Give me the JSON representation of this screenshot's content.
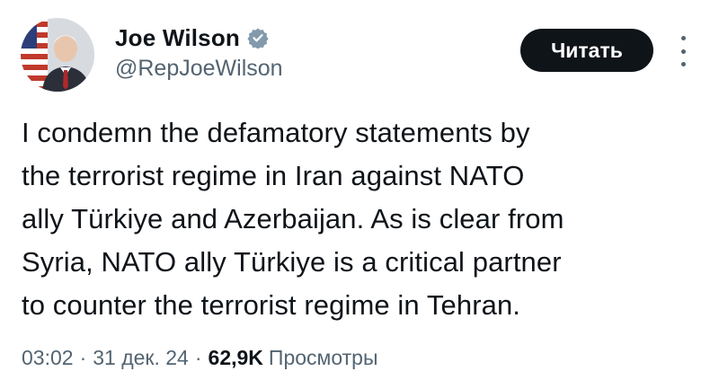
{
  "author": {
    "display_name": "Joe Wilson",
    "handle": "@RepJoeWilson",
    "verified_icon": "verified-badge-icon",
    "verified_color": "#829aab"
  },
  "actions": {
    "follow_label": "Читать",
    "more_icon": "more-vertical-icon"
  },
  "tweet": {
    "text": "I condemn the defamatory statements by\nthe terrorist regime in Iran against NATO\nally Türkiye and Azerbaijan. As is clear from\nSyria, NATO ally Türkiye is a critical partner\nto counter the terrorist regime in Tehran."
  },
  "meta": {
    "time": "03:02",
    "separator": "·",
    "date": "31 дек. 24",
    "views_count": "62,9K",
    "views_label": "Просмотры"
  },
  "colors": {
    "text_primary": "#0f1419",
    "text_secondary": "#536471",
    "button_bg": "#0f1419",
    "button_text": "#ffffff"
  }
}
